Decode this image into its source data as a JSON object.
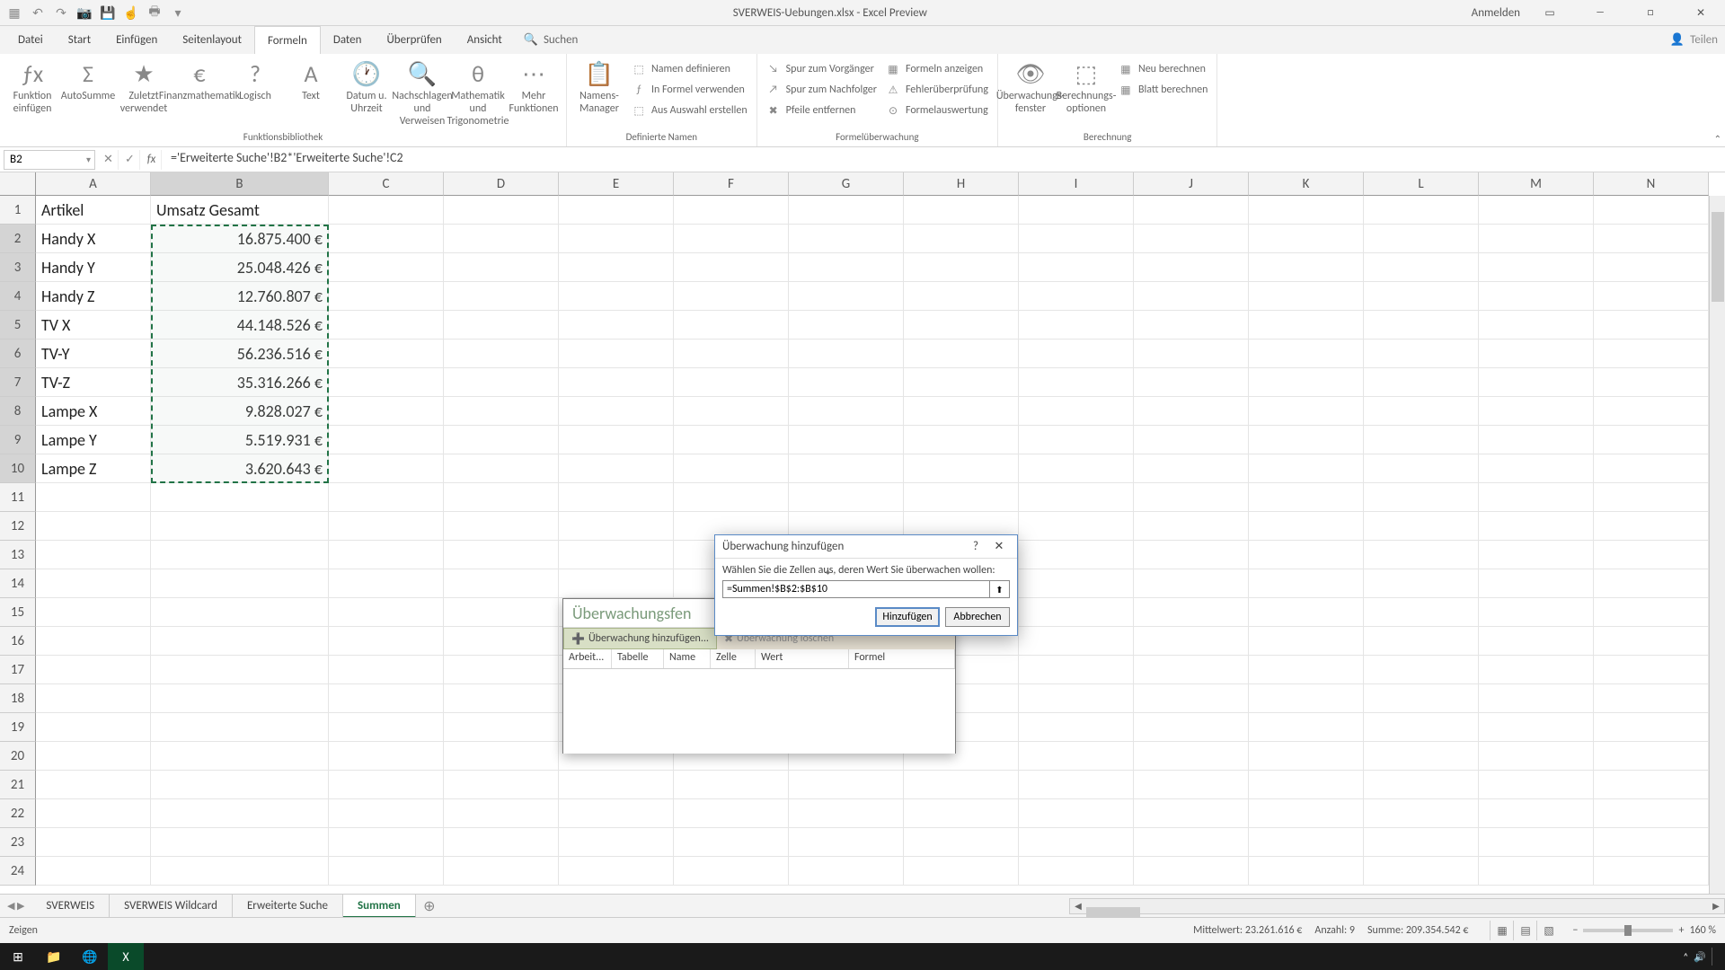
{
  "title": "SVERWEIS-Uebungen.xlsx - Excel Preview",
  "signin": "Anmelden",
  "menu": {
    "tabs": [
      "Datei",
      "Start",
      "Einfügen",
      "Seitenlayout",
      "Formeln",
      "Daten",
      "Überprüfen",
      "Ansicht"
    ],
    "active": "Formeln",
    "search": "Suchen",
    "share": "Teilen"
  },
  "ribbon": {
    "g1": {
      "insert_fn": "Funktion einfügen",
      "autosum": "AutoSumme",
      "recent": "Zuletzt verwendet",
      "financial": "Finanzmathematik",
      "logical": "Logisch",
      "text": "Text",
      "date": "Datum u. Uhrzeit",
      "lookup": "Nachschlagen und Verweisen",
      "math": "Mathematik und Trigonometrie",
      "more": "Mehr Funktionen",
      "label": "Funktionsbibliothek"
    },
    "g2": {
      "name_mgr": "Namens-Manager",
      "define": "Namen definieren",
      "use": "In Formel verwenden",
      "create": "Aus Auswahl erstellen",
      "label": "Definierte Namen"
    },
    "g3": {
      "prec": "Spur zum Vorgänger",
      "dep": "Spur zum Nachfolger",
      "remove": "Pfeile entfernen",
      "show": "Formeln anzeigen",
      "check": "Fehlerüberprüfung",
      "eval": "Formelauswertung",
      "label": "Formelüberwachung"
    },
    "g4": {
      "watch": "Überwachungs-fenster",
      "opts": "Berechnungs-optionen",
      "now": "Neu berechnen",
      "sheet": "Blatt berechnen",
      "label": "Berechnung"
    }
  },
  "namebox": "B2",
  "formula": "='Erweiterte Suche'!B2*'Erweiterte Suche'!C2",
  "columns": [
    "A",
    "B",
    "C",
    "D",
    "E",
    "F",
    "G",
    "H",
    "I",
    "J",
    "K",
    "L",
    "M",
    "N"
  ],
  "row_headers": [
    1,
    2,
    3,
    4,
    5,
    6,
    7,
    8,
    9,
    10,
    11,
    12,
    13,
    14,
    15,
    16,
    17,
    18,
    19,
    20,
    21,
    22,
    23,
    24
  ],
  "data": {
    "hdr_a": "Artikel",
    "hdr_b": "Umsatz Gesamt",
    "rows": [
      {
        "a": "Handy X",
        "b": "16.875.400 €"
      },
      {
        "a": "Handy Y",
        "b": "25.048.426 €"
      },
      {
        "a": "Handy Z",
        "b": "12.760.807 €"
      },
      {
        "a": "TV X",
        "b": "44.148.526 €"
      },
      {
        "a": "TV-Y",
        "b": "56.236.516 €"
      },
      {
        "a": "TV-Z",
        "b": "35.316.266 €"
      },
      {
        "a": "Lampe X",
        "b": "9.828.027 €"
      },
      {
        "a": "Lampe Y",
        "b": "5.519.931 €"
      },
      {
        "a": "Lampe Z",
        "b": "3.620.643 €"
      }
    ]
  },
  "watch": {
    "title": "Überwachungsfen",
    "add": "Überwachung hinzufügen...",
    "del": "Überwachung löschen",
    "cols": {
      "book": "Arbeit...",
      "sheet": "Tabelle",
      "name": "Name",
      "cell": "Zelle",
      "value": "Wert",
      "formula": "Formel"
    }
  },
  "dialog": {
    "title": "Überwachung hinzufügen",
    "label": "Wählen Sie die Zellen aus, deren Wert Sie überwachen wollen:",
    "value": "=Summen!$B$2:$B$10",
    "ok": "Hinzufügen",
    "cancel": "Abbrechen"
  },
  "sheets": {
    "tabs": [
      "SVERWEIS",
      "SVERWEIS Wildcard",
      "Erweiterte Suche",
      "Summen"
    ],
    "active": "Summen"
  },
  "status": {
    "mode": "Zeigen",
    "avg_l": "Mittelwert:",
    "avg_v": "23.261.616 €",
    "cnt_l": "Anzahl:",
    "cnt_v": "9",
    "sum_l": "Summe:",
    "sum_v": "209.354.542 €",
    "zoom": "160 %"
  }
}
